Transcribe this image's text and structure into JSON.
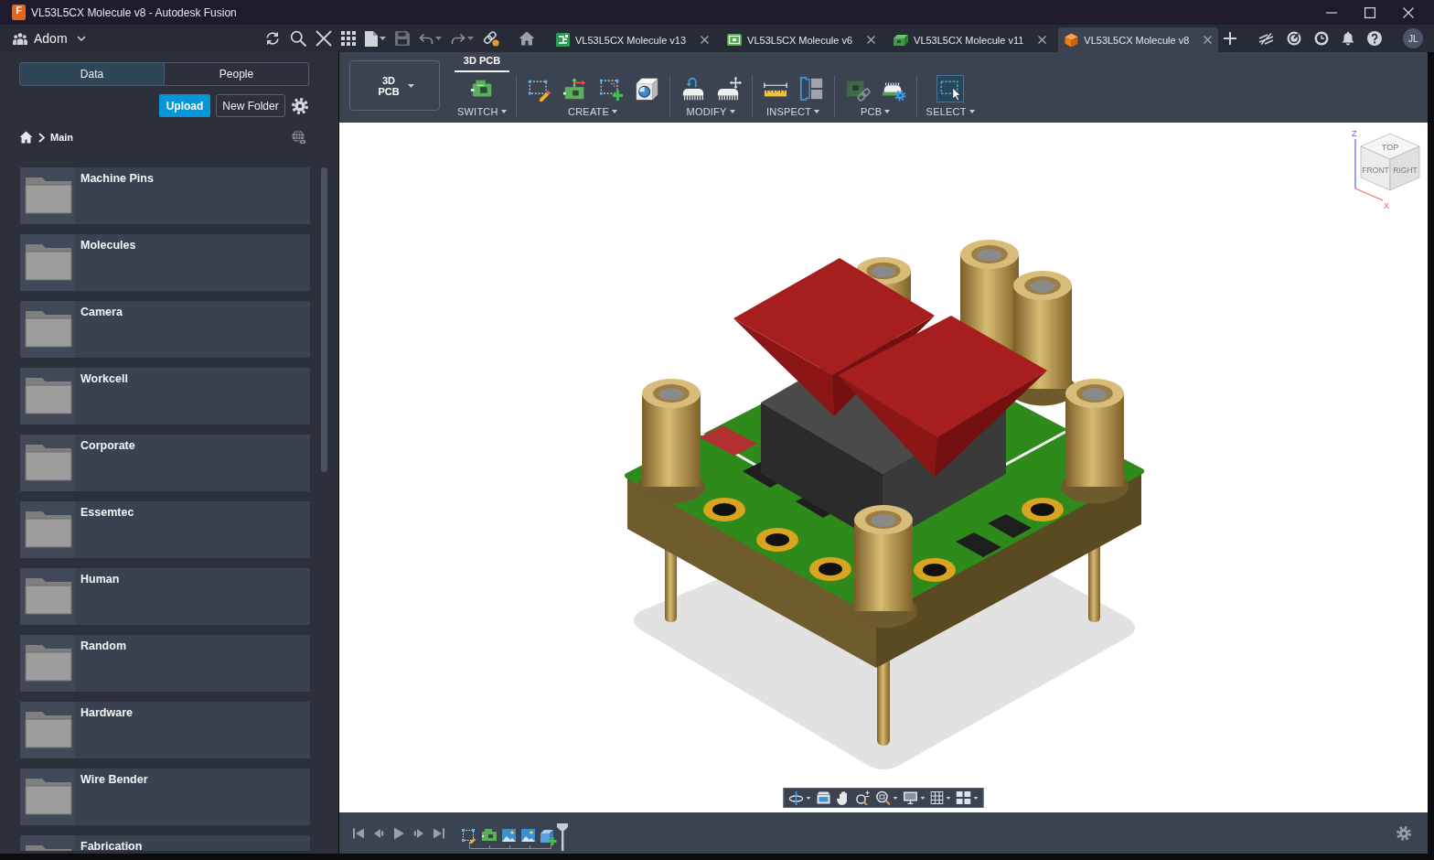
{
  "window": {
    "app_logo": "F",
    "title": "VL53L5CX Molecule v8 - Autodesk Fusion"
  },
  "toolbar": {
    "team": "Adom",
    "avatar_initials": "JL"
  },
  "tabs": [
    {
      "label": "VL53L5CX Molecule v13",
      "kind": "schematic",
      "selected": false
    },
    {
      "label": "VL53L5CX Molecule v6",
      "kind": "pcb",
      "selected": false
    },
    {
      "label": "VL53L5CX Molecule v11",
      "kind": "board3d",
      "selected": false
    },
    {
      "label": "VL53L5CX Molecule v8",
      "kind": "design",
      "selected": true
    }
  ],
  "data_panel": {
    "tabs": [
      {
        "label": "Data",
        "selected": true
      },
      {
        "label": "People",
        "selected": false
      }
    ],
    "upload_button": "Upload",
    "new_folder_button": "New Folder",
    "breadcrumb": "Main",
    "folders": [
      "Machine Pins",
      "Molecules",
      "Camera",
      "Workcell",
      "Corporate",
      "Essemtec",
      "Human",
      "Random",
      "Hardware",
      "Wire Bender",
      "Fabrication"
    ]
  },
  "ribbon": {
    "workspace": "3D PCB",
    "tabs": [
      {
        "label": "3D PCB",
        "selected": true
      }
    ],
    "groups": [
      {
        "label": "SWITCH",
        "active": false
      },
      {
        "label": "CREATE",
        "active": false
      },
      {
        "label": "MODIFY",
        "active": false
      },
      {
        "label": "INSPECT",
        "active": false
      },
      {
        "label": "PCB",
        "active": false
      },
      {
        "label": "SELECT",
        "active": true
      }
    ]
  },
  "viewport": {
    "view_cube": {
      "top": "TOP",
      "front": "FRONT",
      "right": "RIGHT",
      "z_axis": "Z",
      "x_axis": "X"
    }
  }
}
